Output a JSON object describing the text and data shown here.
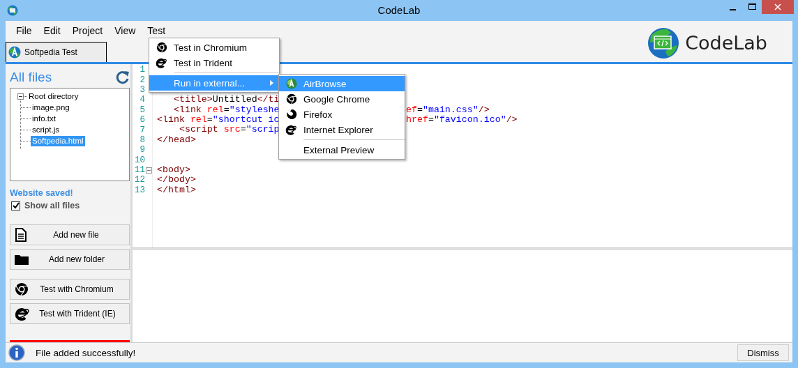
{
  "window": {
    "title": "CodeLab"
  },
  "menu": [
    "File",
    "Edit",
    "Project",
    "View",
    "Test"
  ],
  "tabs": [
    {
      "label": "Softpedia Test"
    }
  ],
  "logo": {
    "text": "CodeLab"
  },
  "sidebar": {
    "title": "All files",
    "tree": [
      {
        "label": "Root directory",
        "expanded": true,
        "selected": false,
        "children": [
          {
            "label": "image.png",
            "selected": false
          },
          {
            "label": "info.txt",
            "selected": false
          },
          {
            "label": "script.js",
            "selected": false
          },
          {
            "label": "Softpedia.html",
            "selected": true
          }
        ]
      }
    ],
    "save_status": "Website saved!",
    "show_all_files": {
      "label": "Show all files",
      "checked": true
    },
    "file_buttons": [
      {
        "kind": "file",
        "label": "Add new file"
      },
      {
        "kind": "folder",
        "label": "Add new folder"
      }
    ],
    "test_buttons": [
      {
        "kind": "chromium",
        "label": "Test with Chromium"
      },
      {
        "kind": "ie",
        "label": "Test with Trident (IE)"
      }
    ]
  },
  "editor": {
    "lines": [
      {
        "number": "1",
        "expanded": false
      },
      {
        "number": "2",
        "expanded": false
      },
      {
        "number": "3",
        "expanded": false
      },
      {
        "number": "4",
        "expanded": false,
        "left": [
          {
            "kind": "tag",
            "text": "   <title>"
          },
          {
            "kind": "text",
            "text": "Untitled"
          },
          {
            "kind": "tag",
            "text": "</ti"
          }
        ]
      },
      {
        "number": "5",
        "expanded": false,
        "left": [
          {
            "kind": "tag",
            "text": "   <link "
          },
          {
            "kind": "attr",
            "text": "rel"
          },
          {
            "kind": "text",
            "text": "="
          },
          {
            "kind": "string",
            "text": "\"styleshe"
          }
        ],
        "right": [
          {
            "kind": "attr",
            "text": "ef"
          },
          {
            "kind": "text",
            "text": "="
          },
          {
            "kind": "string",
            "text": "\"main.css\""
          },
          {
            "kind": "tag",
            "text": "/>"
          }
        ]
      },
      {
        "number": "6",
        "expanded": false,
        "left": [
          {
            "kind": "tag",
            "text": "<link "
          },
          {
            "kind": "attr",
            "text": "rel"
          },
          {
            "kind": "text",
            "text": "="
          },
          {
            "kind": "string",
            "text": "\"shortcut ic"
          }
        ],
        "right": [
          {
            "kind": "attr",
            "text": "href"
          },
          {
            "kind": "text",
            "text": "="
          },
          {
            "kind": "string",
            "text": "\"favicon.ico\""
          },
          {
            "kind": "tag",
            "text": "/>"
          }
        ]
      },
      {
        "number": "7",
        "expanded": false,
        "left": [
          {
            "kind": "tag",
            "text": "    <script "
          },
          {
            "kind": "attr",
            "text": "src"
          },
          {
            "kind": "text",
            "text": "="
          },
          {
            "kind": "string",
            "text": "\"scrip"
          }
        ]
      },
      {
        "number": "8",
        "expanded": false,
        "left": [
          {
            "kind": "tag",
            "text": "</head>"
          }
        ]
      },
      {
        "number": "9",
        "expanded": false
      },
      {
        "number": "10",
        "expanded": false
      },
      {
        "number": "11",
        "expanded": true,
        "left": [
          {
            "kind": "tag",
            "text": "<body>"
          }
        ]
      },
      {
        "number": "12",
        "expanded": false,
        "left": [
          {
            "kind": "tag",
            "text": "</body>"
          }
        ]
      },
      {
        "number": "13",
        "expanded": false,
        "left": [
          {
            "kind": "tag",
            "text": "</html>"
          }
        ]
      }
    ]
  },
  "test_menu": [
    {
      "kind": "chromium",
      "label": "Test in Chromium",
      "selected": false
    },
    {
      "kind": "ie",
      "label": "Test in Trident",
      "selected": false
    },
    {
      "kind": "separator"
    },
    {
      "kind": "submenu",
      "label": "Run in external...",
      "selected": true
    }
  ],
  "external_menu": [
    {
      "kind": "airbrowse",
      "label": "AirBrowse",
      "selected": true
    },
    {
      "kind": "chromium",
      "label": "Google Chrome",
      "selected": false
    },
    {
      "kind": "firefox",
      "label": "Firefox",
      "selected": false
    },
    {
      "kind": "ie",
      "label": "Internet Explorer",
      "selected": false
    },
    {
      "kind": "separator"
    },
    {
      "kind": "plain",
      "label": "External Preview",
      "selected": false
    }
  ],
  "status_bar": {
    "message": "File added successfully!",
    "button": "Dismiss"
  }
}
